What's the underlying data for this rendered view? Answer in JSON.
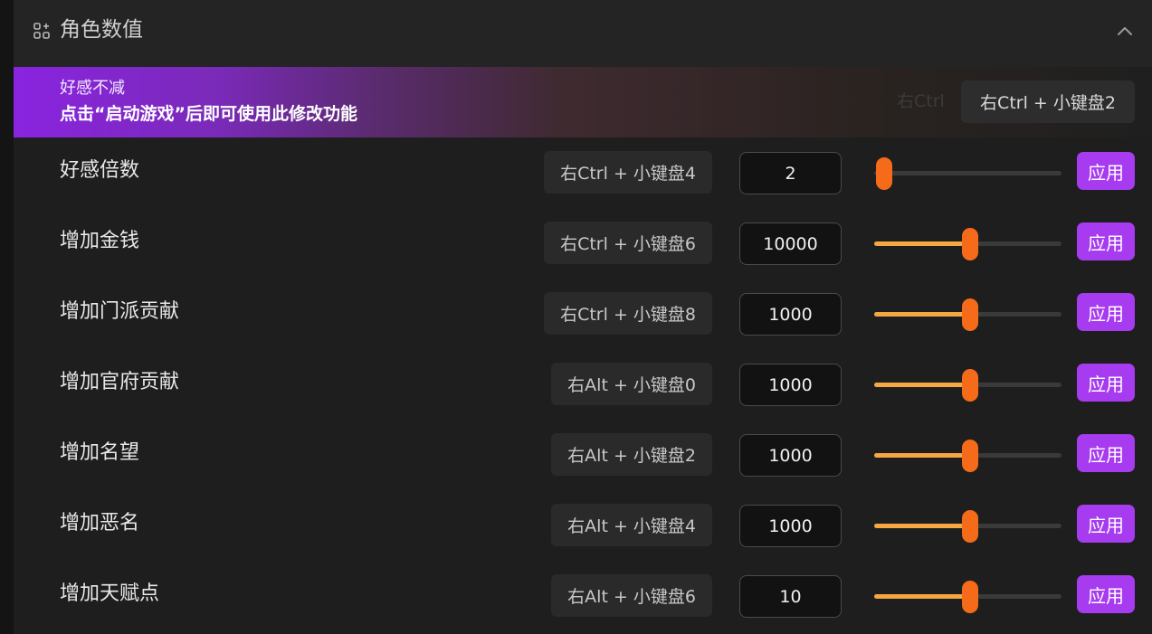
{
  "section": {
    "title": "角色数值",
    "icon": "grid-add-icon",
    "collapse_icon": "chevron-up-icon"
  },
  "banner": {
    "title": "好感不减",
    "subtitle": "点击“启动游戏”后即可使用此修改功能",
    "ghost_text": "右Ctrl",
    "hotkey": "右Ctrl + 小键盘2"
  },
  "colors": {
    "accent_purple": "#a63bf0",
    "slider_fill": "#f5a742",
    "slider_thumb": "#f56b1a"
  },
  "rows": [
    {
      "label": "好感倍数",
      "hotkey": "右Ctrl + 小键盘4",
      "value": "2",
      "slider_fraction": 0.0,
      "apply": "应用"
    },
    {
      "label": "增加金钱",
      "hotkey": "右Ctrl + 小键盘6",
      "value": "10000",
      "slider_fraction": 0.5,
      "apply": "应用"
    },
    {
      "label": "增加门派贡献",
      "hotkey": "右Ctrl + 小键盘8",
      "value": "1000",
      "slider_fraction": 0.5,
      "apply": "应用"
    },
    {
      "label": "增加官府贡献",
      "hotkey": "右Alt + 小键盘0",
      "value": "1000",
      "slider_fraction": 0.5,
      "apply": "应用"
    },
    {
      "label": "增加名望",
      "hotkey": "右Alt + 小键盘2",
      "value": "1000",
      "slider_fraction": 0.5,
      "apply": "应用"
    },
    {
      "label": "增加恶名",
      "hotkey": "右Alt + 小键盘4",
      "value": "1000",
      "slider_fraction": 0.5,
      "apply": "应用"
    },
    {
      "label": "增加天赋点",
      "hotkey": "右Alt + 小键盘6",
      "value": "10",
      "slider_fraction": 0.5,
      "apply": "应用"
    }
  ]
}
